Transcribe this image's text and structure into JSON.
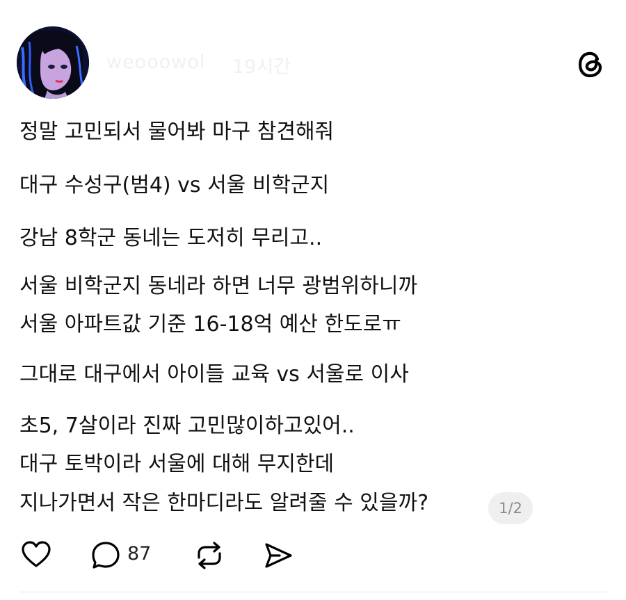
{
  "post": {
    "username": "weooowol",
    "time": "19시간",
    "lines": [
      "정말 고민되서 물어봐 마구 참견해줘",
      "대구 수성구(범4) vs 서울 비학군지",
      "강남 8학군 동네는 도저히 무리고..",
      "서울 비학군지 동네라 하면 너무 광범위하니까",
      "서울 아파트값 기준 16-18억 예산 한도로ㅠ",
      "그대로 대구에서 아이들 교육 vs 서울로 이사",
      "초5, 7살이라 진짜 고민많이하고있어..",
      "대구 토박이라 서울에 대해 무지한데",
      "지나가면서 작은 한마디라도 알려줄 수 있을까?"
    ],
    "page_indicator": "1/2"
  },
  "actions": {
    "comment_count": "87",
    "icons": [
      "heart-icon",
      "comment-icon",
      "repost-icon",
      "share-icon"
    ]
  },
  "colors": {
    "text": "#111111",
    "muted": "#8a8a8a",
    "badge_bg": "#efefef",
    "avatar_bg": "#0a0f2a"
  }
}
